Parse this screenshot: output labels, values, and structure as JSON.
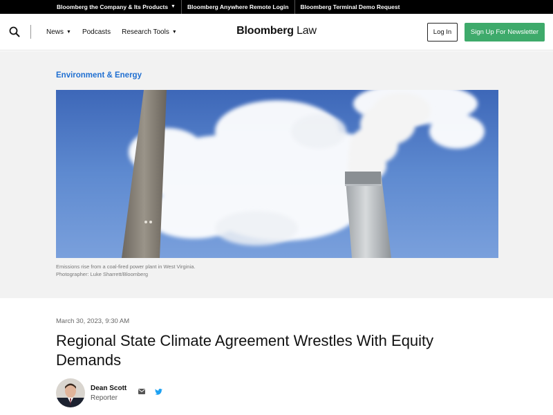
{
  "topbar": {
    "links": [
      {
        "label": "Bloomberg the Company & Its Products",
        "has_caret": true
      },
      {
        "label": "Bloomberg Anywhere Remote Login"
      },
      {
        "label": "Bloomberg Terminal Demo Request"
      }
    ],
    "caret": "▼"
  },
  "header": {
    "nav": [
      {
        "label": "News",
        "caret": "▼"
      },
      {
        "label": "Podcasts"
      },
      {
        "label": "Research Tools",
        "caret": "▼"
      }
    ],
    "logo_main": "Bloomberg",
    "logo_sub": "Law",
    "login_label": "Log In",
    "signup_label": "Sign Up For Newsletter",
    "signup_color": "#3eaa6b"
  },
  "hero": {
    "category": "Environment & Energy",
    "caption_line1": "Emissions rise from a coal-fired power plant in West Virginia.",
    "caption_line2": "Photographer: Luke Sharrett/Bloomberg"
  },
  "article": {
    "date": "March 30, 2023, 9:30 AM",
    "headline": "Regional State Climate Agreement Wrestles With Equity Demands",
    "author_name": "Dean Scott",
    "author_role": "Reporter"
  },
  "icons": {
    "search": "search-icon",
    "email": "email-icon",
    "twitter": "twitter-icon"
  }
}
